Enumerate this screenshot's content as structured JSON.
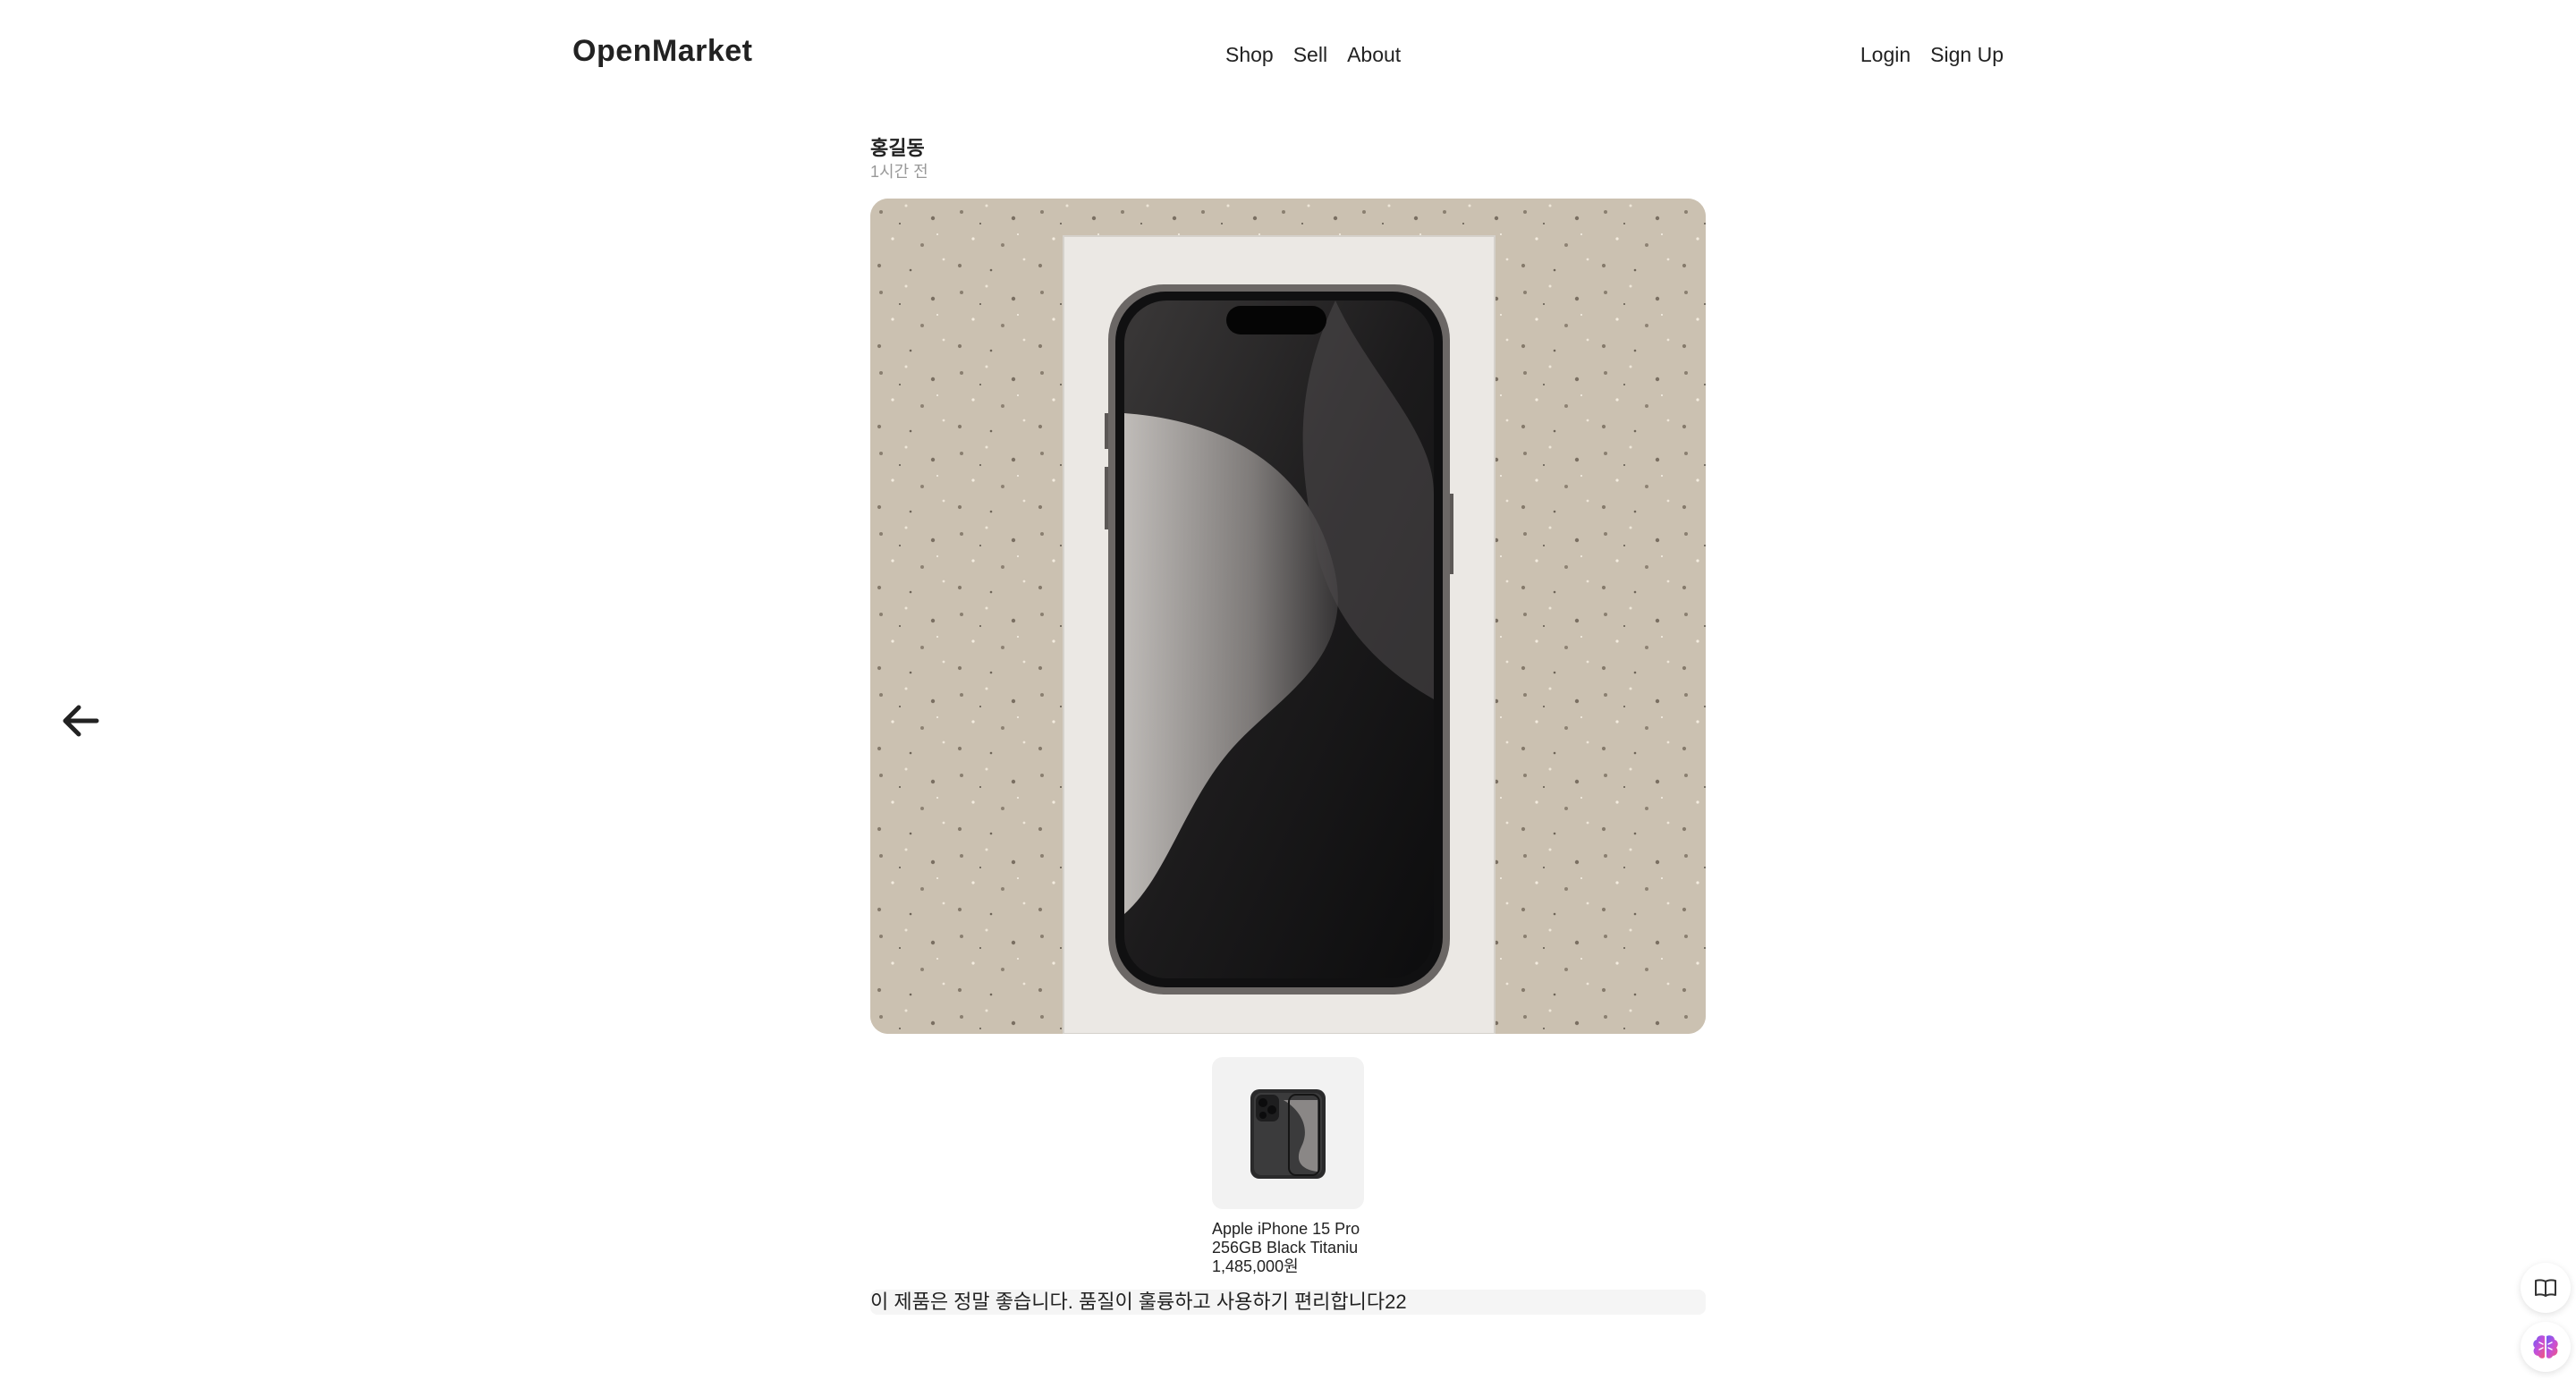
{
  "header": {
    "brand": "OpenMarket",
    "nav": [
      "Shop",
      "Sell",
      "About"
    ],
    "auth": [
      "Login",
      "Sign Up"
    ]
  },
  "post": {
    "author": "홍길동",
    "time": "1시간 전",
    "comment": "이 제품은 정말 좋습니다. 품질이 훌륭하고 사용하기 편리합니다22"
  },
  "product": {
    "name": "Apple iPhone 15 Pro 256GB Black Titaniu",
    "price": "1,485,000원"
  },
  "icons": {
    "back": "arrow-left-icon",
    "reader": "book-open-icon",
    "assistant": "brain-icon"
  },
  "colors": {
    "background": "#ffffff",
    "text": "#222222",
    "muted": "#999999",
    "thumb_bg": "#f2f2f2"
  }
}
